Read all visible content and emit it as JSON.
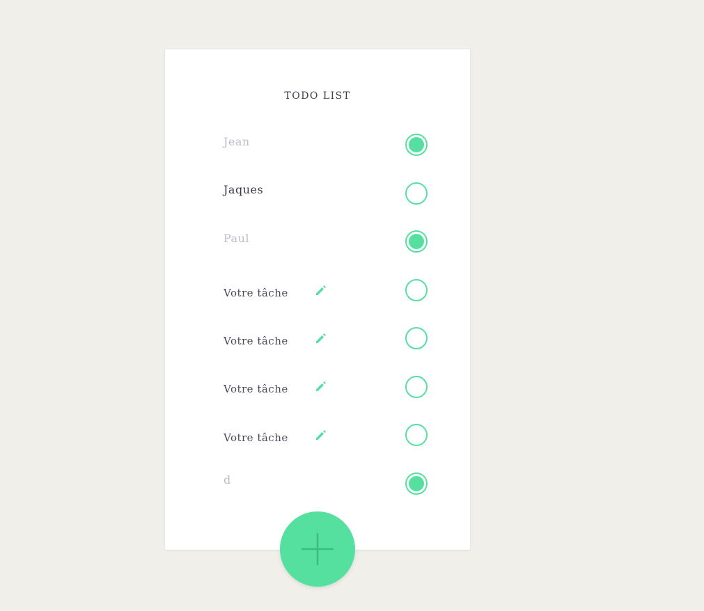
{
  "app": {
    "title": "TODO LIST"
  },
  "colors": {
    "accent": "#55e0a0",
    "background": "#f0efea",
    "card": "#ffffff",
    "text_dark": "#3d3a4a",
    "text_done": "#bdbbc8"
  },
  "items": [
    {
      "label": "Jean",
      "checked": true,
      "editable": false
    },
    {
      "label": "Jaques",
      "checked": false,
      "editable": false
    },
    {
      "label": "Paul",
      "checked": true,
      "editable": false
    },
    {
      "label": "Votre tâche",
      "checked": false,
      "editable": true,
      "icon": "pencil-icon"
    },
    {
      "label": "Votre tâche",
      "checked": false,
      "editable": true,
      "icon": "pencil-icon"
    },
    {
      "label": "Votre tâche",
      "checked": false,
      "editable": true,
      "icon": "pencil-icon"
    },
    {
      "label": "Votre tâche",
      "checked": false,
      "editable": true,
      "icon": "pencil-icon"
    },
    {
      "label": "d",
      "checked": true,
      "editable": false
    }
  ],
  "fab": {
    "icon": "plus-icon"
  }
}
